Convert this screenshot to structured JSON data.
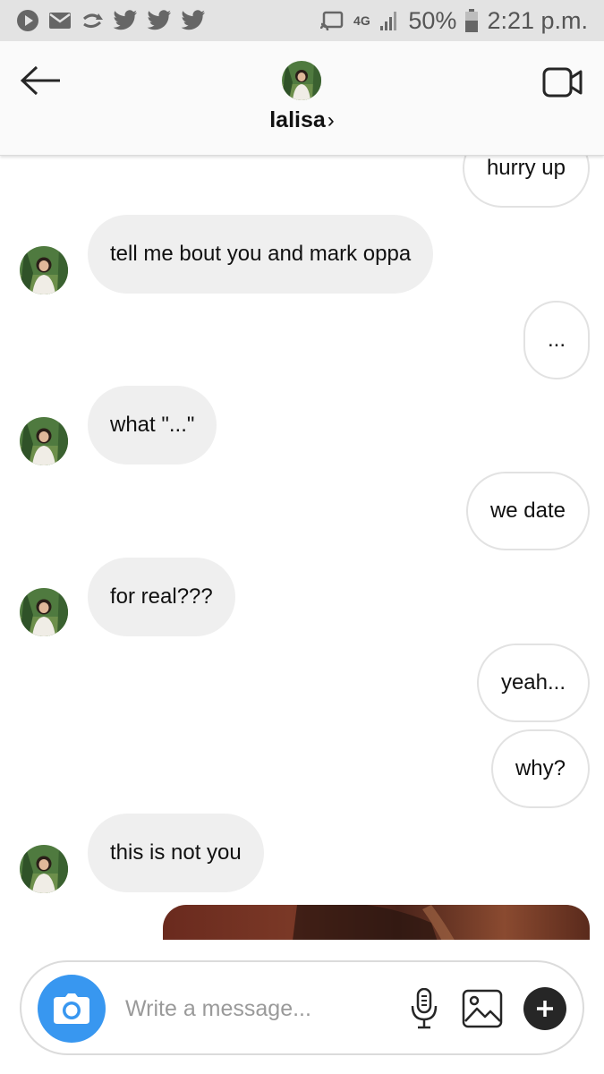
{
  "status_bar": {
    "network": "4G",
    "battery": "50%",
    "time": "2:21 p.m.",
    "icons": [
      "play-icon",
      "mail-icon",
      "data-sync-icon",
      "twitter-icon",
      "twitter-icon",
      "twitter-icon",
      "cast-icon",
      "signal-icon",
      "battery-icon"
    ]
  },
  "header": {
    "username": "lalisa",
    "chevron": "›",
    "icons": [
      "back-arrow-icon",
      "video-camera-icon"
    ]
  },
  "messages": [
    {
      "from": "me",
      "text": "hurry up"
    },
    {
      "from": "them",
      "text": "tell me bout you and mark oppa"
    },
    {
      "from": "me",
      "text": "..."
    },
    {
      "from": "them",
      "text": "what \"...\""
    },
    {
      "from": "me",
      "text": "we date"
    },
    {
      "from": "them",
      "text": "for real???"
    },
    {
      "from": "me",
      "text": "yeah..."
    },
    {
      "from": "me",
      "text": "why?"
    },
    {
      "from": "them",
      "text": "this is not you"
    },
    {
      "from": "me",
      "type": "image"
    }
  ],
  "composer": {
    "placeholder": "Write a message...",
    "icons": [
      "camera-icon",
      "microphone-icon",
      "gallery-icon",
      "plus-icon"
    ]
  },
  "colors": {
    "accent_blue": "#3897f0",
    "incoming_bubble": "#efefef",
    "outgoing_border": "#e2e2e2",
    "status_bar_bg": "#e3e3e3"
  }
}
